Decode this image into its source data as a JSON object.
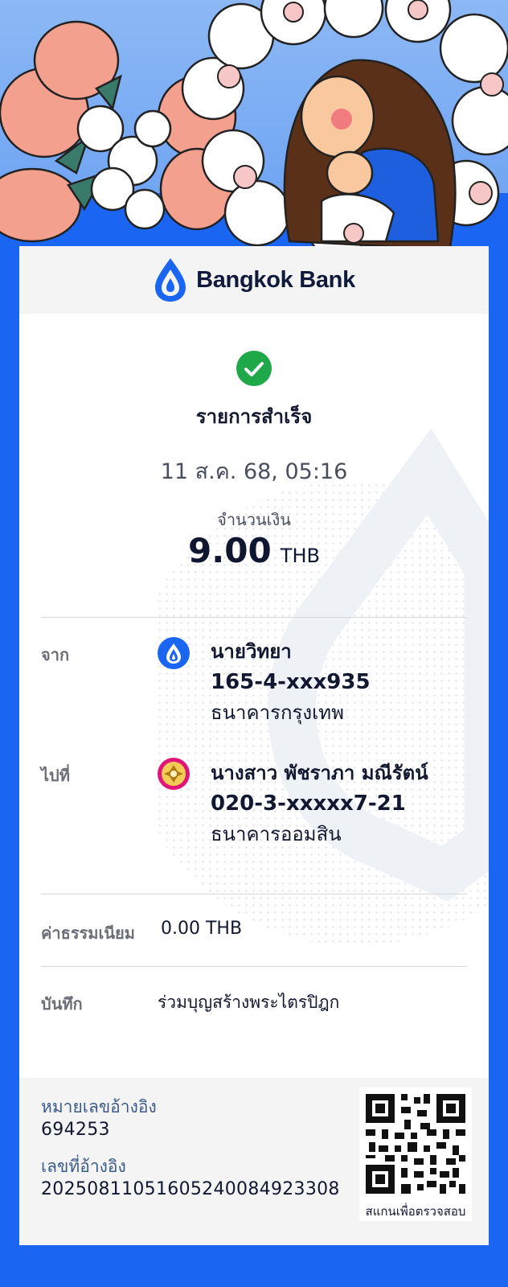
{
  "brand": {
    "name": "Bangkok Bank",
    "color": "#1a66f2"
  },
  "receipt": {
    "status": "รายการสำเร็จ",
    "date": "11 ส.ค. 68, 05:16",
    "amount_label": "จำนวนเงิน",
    "amount": "9.00",
    "currency": "THB"
  },
  "from": {
    "label": "จาก",
    "icon": "bangkok-bank-logo-icon",
    "name": "นายวิทยา",
    "account": "165-4-xxx935",
    "bank": "ธนาคารกรุงเทพ"
  },
  "to": {
    "label": "ไปที่",
    "icon": "gsb-bank-logo-icon",
    "name": "นางสาว พัชราภา มณีรัตน์",
    "account": "020-3-xxxxx7-21",
    "bank": "ธนาคารออมสิน"
  },
  "fee": {
    "label": "ค่าธรรมเนียม",
    "value": "0.00 THB"
  },
  "memo": {
    "label": "บันทึก",
    "value": "ร่วมบุญสร้างพระไตรปิฎก"
  },
  "footer": {
    "ref_label_1": "หมายเลขอ้างอิง",
    "ref_value_1": "694253",
    "ref_label_2": "เลขที่อ้างอิง",
    "ref_value_2": "20250811051605240084923308",
    "qr_caption": "สแกนเพื่อตรวจสอบ"
  },
  "colors": {
    "success": "#1fa84a",
    "page_bg": "#1a66f2",
    "card_bg": "#ffffff",
    "header_bg": "#f4f4f4"
  }
}
